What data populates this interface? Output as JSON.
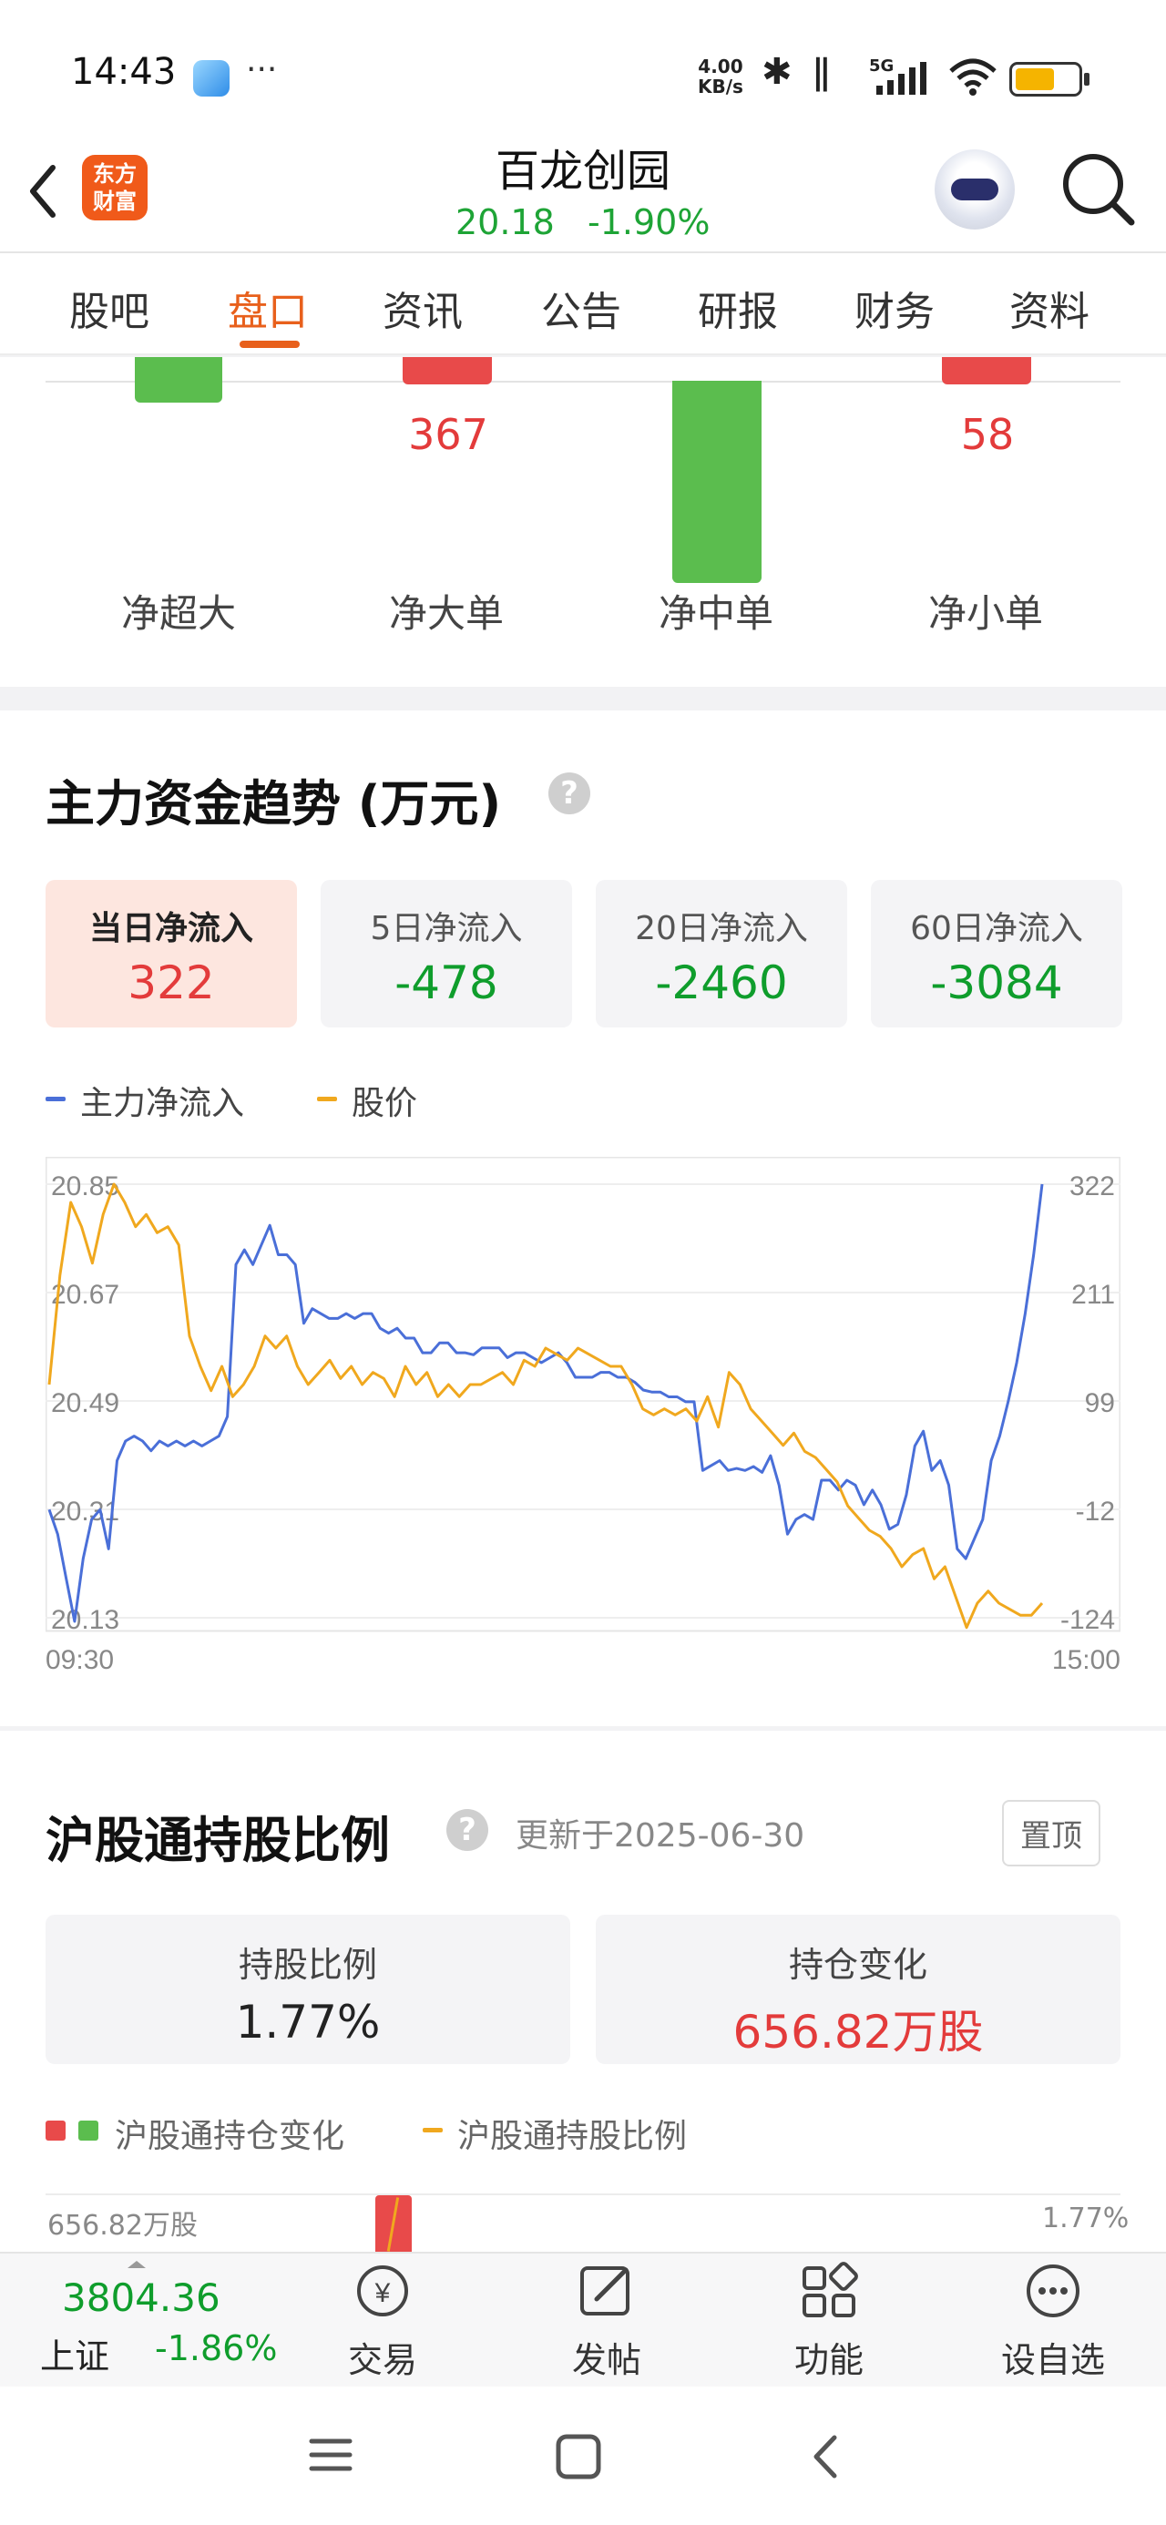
{
  "status": {
    "time": "14:43",
    "more": "···",
    "net_speed_value": "4.00",
    "net_speed_unit": "KB/s",
    "signal_label": "5G"
  },
  "header": {
    "logo_line1": "东方",
    "logo_line2": "财富",
    "stock_name": "百龙创园",
    "price": "20.18",
    "change": "-1.90%"
  },
  "tabs": [
    {
      "label": "股吧"
    },
    {
      "label": "盘口"
    },
    {
      "label": "资讯"
    },
    {
      "label": "公告"
    },
    {
      "label": "研报"
    },
    {
      "label": "财务"
    },
    {
      "label": "资料"
    }
  ],
  "active_tab": "盘口",
  "net_flow_bars": {
    "items": [
      {
        "label": "净超大",
        "value": "",
        "direction": "negative"
      },
      {
        "label": "净大单",
        "value": "367",
        "direction": "positive"
      },
      {
        "label": "净中单",
        "value": "",
        "direction": "negative"
      },
      {
        "label": "净小单",
        "value": "58",
        "direction": "positive"
      }
    ]
  },
  "trend": {
    "title": "主力资金趋势 (万元)",
    "help": "?",
    "cards": [
      {
        "label": "当日净流入",
        "value": "322"
      },
      {
        "label": "5日净流入",
        "value": "-478"
      },
      {
        "label": "20日净流入",
        "value": "-2460"
      },
      {
        "label": "60日净流入",
        "value": "-3084"
      }
    ],
    "legend": [
      {
        "name": "主力净流入",
        "color": "#4a6fd8"
      },
      {
        "name": "股价",
        "color": "#f0a81e"
      }
    ]
  },
  "chart_data": {
    "type": "line",
    "x_start": "09:30",
    "x_end": "15:00",
    "y_left_ticks": [
      "20.85",
      "20.67",
      "20.49",
      "20.31",
      "20.13"
    ],
    "y_right_ticks": [
      "322",
      "211",
      "99",
      "-12",
      "-124"
    ],
    "y_left_range": [
      20.13,
      20.85
    ],
    "y_right_range": [
      -124,
      322
    ],
    "grid": true,
    "series": [
      {
        "name": "主力净流入",
        "color": "#4a6fd8",
        "axis": "right",
        "values": [
          -10,
          -35,
          -80,
          -124,
          -60,
          -20,
          -10,
          -50,
          40,
          60,
          65,
          60,
          50,
          60,
          55,
          60,
          55,
          60,
          55,
          60,
          65,
          85,
          240,
          255,
          240,
          260,
          280,
          250,
          250,
          240,
          180,
          195,
          190,
          185,
          185,
          190,
          185,
          190,
          190,
          175,
          170,
          175,
          165,
          165,
          150,
          150,
          160,
          160,
          150,
          150,
          148,
          155,
          155,
          155,
          145,
          150,
          150,
          145,
          140,
          145,
          150,
          140,
          125,
          125,
          125,
          130,
          130,
          125,
          125,
          120,
          112,
          110,
          110,
          105,
          105,
          100,
          100,
          30,
          35,
          40,
          30,
          32,
          30,
          34,
          28,
          45,
          15,
          -35,
          -20,
          -15,
          -20,
          20,
          20,
          10,
          20,
          15,
          -5,
          10,
          -5,
          -30,
          -25,
          5,
          55,
          70,
          30,
          40,
          15,
          -50,
          -60,
          -40,
          -20,
          40,
          65,
          100,
          140,
          190,
          250,
          322
        ]
      },
      {
        "name": "股价",
        "color": "#f0a81e",
        "axis": "left",
        "values": [
          20.52,
          20.7,
          20.82,
          20.78,
          20.72,
          20.8,
          20.85,
          20.82,
          20.78,
          20.8,
          20.77,
          20.78,
          20.75,
          20.6,
          20.55,
          20.51,
          20.55,
          20.5,
          20.52,
          20.55,
          20.6,
          20.58,
          20.6,
          20.55,
          20.52,
          20.54,
          20.56,
          20.53,
          20.55,
          20.52,
          20.54,
          20.53,
          20.5,
          20.55,
          20.52,
          20.54,
          20.5,
          20.52,
          20.5,
          20.52,
          20.52,
          20.53,
          20.54,
          20.52,
          20.56,
          20.55,
          20.58,
          20.57,
          20.56,
          20.58,
          20.57,
          20.56,
          20.55,
          20.55,
          20.52,
          20.48,
          20.47,
          20.48,
          20.47,
          20.48,
          20.46,
          20.5,
          20.45,
          20.54,
          20.52,
          20.48,
          20.46,
          20.44,
          20.42,
          20.44,
          20.41,
          20.4,
          20.38,
          20.36,
          20.32,
          20.3,
          20.28,
          20.27,
          20.25,
          20.22,
          20.24,
          20.25,
          20.2,
          20.22,
          20.17,
          20.12,
          20.16,
          20.18,
          20.16,
          20.15,
          20.14,
          20.14,
          20.16
        ]
      }
    ]
  },
  "hk_connect": {
    "title": "沪股通持股比例",
    "help": "?",
    "updated": "更新于2025-06-30",
    "pin_label": "置顶",
    "holding_ratio_label": "持股比例",
    "holding_ratio_value": "1.77%",
    "position_change_label": "持仓变化",
    "position_change_value": "656.82万股",
    "legend_bar": "沪股通持仓变化",
    "legend_line": "沪股通持股比例",
    "axis_left_top": "656.82万股",
    "axis_right_top": "1.77%"
  },
  "bottom_bar": {
    "index_value": "3804.36",
    "index_name": "上证",
    "index_change": "-1.86%",
    "items": [
      {
        "label": "交易",
        "icon": "yen-circle-icon"
      },
      {
        "label": "发帖",
        "icon": "compose-icon"
      },
      {
        "label": "功能",
        "icon": "grid-icon"
      },
      {
        "label": "设自选",
        "icon": "more-circle-icon"
      }
    ]
  }
}
